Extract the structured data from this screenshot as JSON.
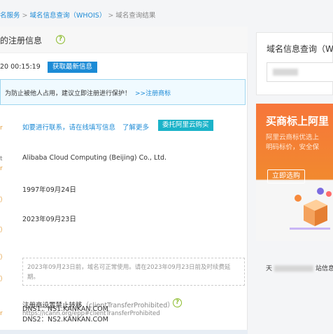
{
  "breadcrumb": {
    "item1": "名服务",
    "item2": "域名信息查询（WHOIS）",
    "item3": "域名查询结果",
    "sep": ">"
  },
  "section": {
    "title": "的注册信息",
    "help": "?"
  },
  "refresh": {
    "time": "20 00:15:19",
    "button": "获取最新信息"
  },
  "notice": {
    "text": "为防止被他人占用，建议立即注册进行保护！",
    "link": ">>注册商标"
  },
  "contact": {
    "link": "如要进行联系，请在线填写信息",
    "learn_more": "了解更多",
    "buy_button": "委托阿里云购买"
  },
  "side_marks": [
    "r",
    "t",
    "r",
    "）",
    "）",
    "）",
    "）",
    "r",
    "r"
  ],
  "registrar": "Alibaba Cloud Computing (Beijing) Co., Ltd.",
  "created": "1997年09月24日",
  "expires": "2023年09月23日",
  "expire_note": "2023年09月23日前，域名可正常使用。请在2023年09月23日前及时续费延期。",
  "status": {
    "text": "注册商设置禁止转移",
    "code": "（clientTransferProhibited）",
    "help": "?",
    "url": "https://icann.org/epp#clientTransferProhibited"
  },
  "dns": [
    "DNS1：NS1.KANKAN.COM",
    "DNS2：NS2.KANKAN.COM"
  ],
  "right": {
    "title": "域名信息查询（W",
    "ad": {
      "title": "买商标上阿里",
      "sub1": "阿里云商标优选上",
      "sub2": "明码标价，安全保",
      "button": "立即选购"
    },
    "footer_prefix": "天",
    "footer_suffix": "站信息"
  },
  "colors": {
    "link": "#1e8bd6",
    "primary_button": "#1b8bd6",
    "buy_button": "#1bb3c9",
    "ad_orange": "#f7763a",
    "help_green": "#8cbc2d"
  }
}
